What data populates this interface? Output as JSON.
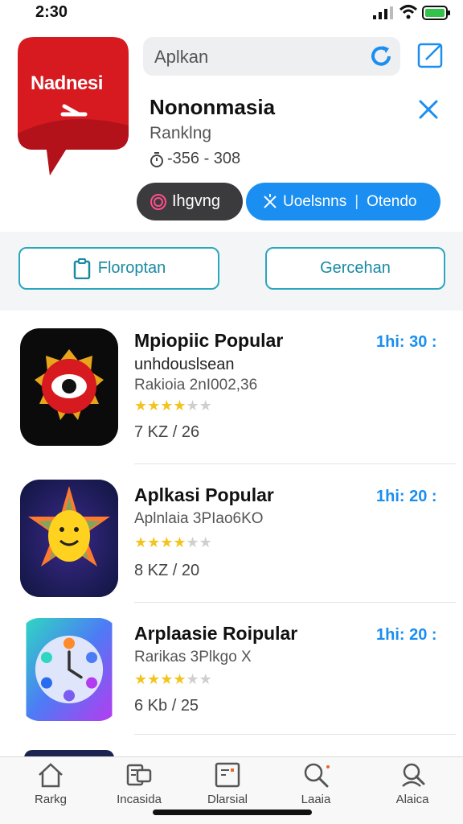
{
  "status": {
    "time": "2:30"
  },
  "header": {
    "app_icon_label": "Nadnesi",
    "search_placeholder": "Aplkan",
    "title": "Nononmasia",
    "subtitle": "Ranklng",
    "meta": "-356 - 308",
    "btn_dark_label": "Ihgvng",
    "btn_blue_label_a": "Uoelsnns",
    "btn_blue_label_b": "Otendo"
  },
  "actions": {
    "left_label": "Floroptan",
    "right_label": "Gercehan"
  },
  "list": [
    {
      "name": "Mpiopiic Popular",
      "sub": "unhdouslsean",
      "desc": "Rakioia 2nI002,36",
      "time": "1hi: 30 :",
      "rating": 4.5,
      "size": "7 KZ / 26"
    },
    {
      "name": "Aplkasi Popular",
      "desc": "Aplnlaia 3PIao6KO",
      "time": "1hi: 20 :",
      "rating": 4.5,
      "size": "8 KZ / 20"
    },
    {
      "name": "Arplaasie Roipular",
      "desc": "Rarikas 3Plkgo X",
      "time": "1hi: 20 :",
      "rating": 4.5,
      "size": "6 Kb / 25"
    }
  ],
  "tabs": [
    {
      "label": "Rarkg",
      "icon": "home-icon"
    },
    {
      "label": "Incasida",
      "icon": "apps-icon"
    },
    {
      "label": "Dlarsial",
      "icon": "window-icon"
    },
    {
      "label": "Laaia",
      "icon": "search-icon"
    },
    {
      "label": "Alaica",
      "icon": "profile-icon"
    }
  ],
  "colors": {
    "accent": "#1a8ef1",
    "outline": "#2aa6bf",
    "brand_red": "#d71920",
    "star": "#f3c41e"
  }
}
